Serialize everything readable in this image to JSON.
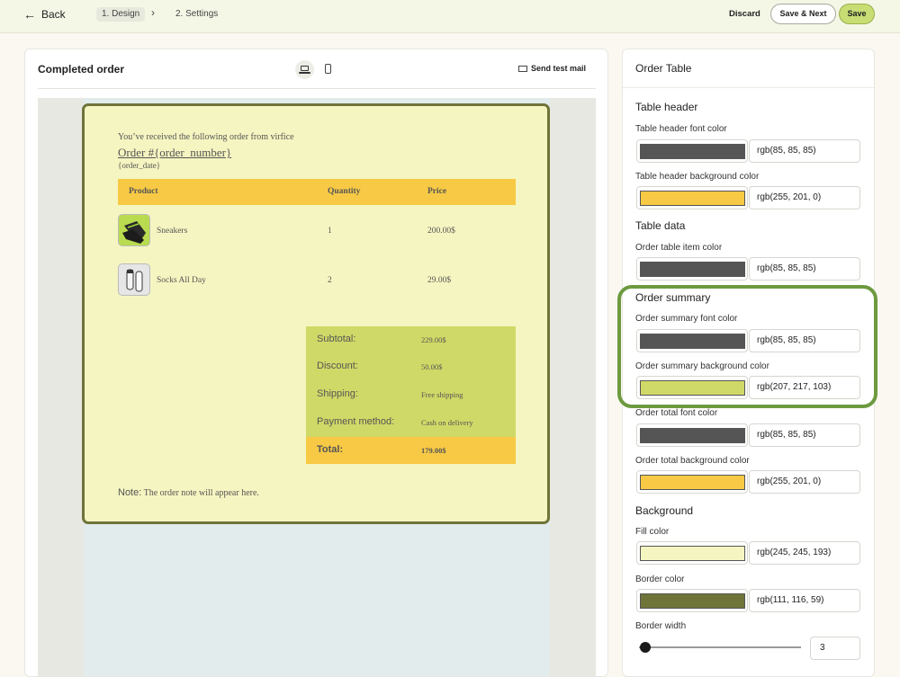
{
  "topbar": {
    "back_label": "Back",
    "steps": [
      "1. Design",
      "2. Settings"
    ],
    "discard_label": "Discard",
    "save_next_label": "Save & Next",
    "save_label": "Save"
  },
  "preview": {
    "title": "Completed order",
    "send_test_label": "Send test mail",
    "device_icons": [
      "desktop-icon",
      "mobile-icon"
    ]
  },
  "email": {
    "intro": "You’ve received the following order from virfice",
    "order_number": "Order #{order_number}",
    "order_date": "{order_date}",
    "table_headers": [
      "Product",
      "Quantity",
      "Price"
    ],
    "items": [
      {
        "name": "Sneakers",
        "quantity": "1",
        "price": "200.00$"
      },
      {
        "name": "Socks All Day",
        "quantity": "2",
        "price": "29.00$"
      }
    ],
    "summary": [
      {
        "label": "Subtotal:",
        "value": "229.00$"
      },
      {
        "label": "Discount:",
        "value": "50.00$"
      },
      {
        "label": "Shipping:",
        "value": "Free shipping"
      },
      {
        "label": "Payment method:",
        "value": "Cash on delivery"
      }
    ],
    "total": {
      "label": "Total:",
      "value": "179.00$"
    },
    "note_label": "Note:",
    "note_text": "The order note will appear here."
  },
  "panel": {
    "title": "Order Table",
    "sections": {
      "table_header": "Table header",
      "table_data": "Table data",
      "order_summary": "Order summary",
      "background": "Background"
    },
    "fields": [
      {
        "label": "Table header font color",
        "value": "rgb(85, 85, 85)",
        "color": "#555555"
      },
      {
        "label": "Table header background color",
        "value": "rgb(255, 201, 0)",
        "color": "#f7c945"
      },
      {
        "label": "Order table item color",
        "value": "rgb(85, 85, 85)",
        "color": "#555555"
      },
      {
        "label": "Order summary font color",
        "value": "rgb(85, 85, 85)",
        "color": "#555555"
      },
      {
        "label": "Order summary background color",
        "value": "rgb(207, 217, 103)",
        "color": "#cfd967"
      },
      {
        "label": "Order total font color",
        "value": "rgb(85, 85, 85)",
        "color": "#555555"
      },
      {
        "label": "Order total background color",
        "value": "rgb(255, 201, 0)",
        "color": "#f7c945"
      },
      {
        "label": "Fill color",
        "value": "rgb(245, 245, 193)",
        "color": "#f5f5c1"
      },
      {
        "label": "Border color",
        "value": "rgb(111, 116, 59)",
        "color": "#6f7439"
      }
    ],
    "border_width_label": "Border width",
    "border_width_value": "3"
  }
}
